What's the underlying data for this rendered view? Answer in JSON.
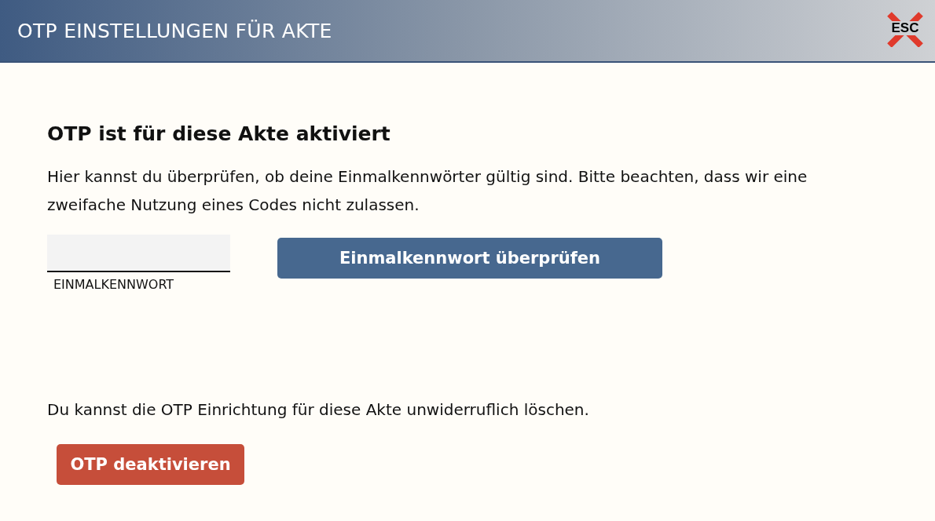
{
  "header": {
    "title": "OTP EINSTELLUNGEN FÜR AKTE",
    "close_label": "ESC"
  },
  "status_heading": "OTP ist für diese Akte aktiviert",
  "intro": "Hier kannst du überprüfen, ob deine Einmalkennwörter gültig sind. Bitte beachten, dass wir eine zweifache Nutzung eines Codes nicht zulassen.",
  "otp_field": {
    "label": "EINMALKENNWORT"
  },
  "verify_button": "Einmalkennwort überprüfen",
  "delete_text": "Du kannst die OTP Einrichtung für diese Akte unwiderruflich löschen.",
  "deactivate_button": "OTP deaktivieren"
}
